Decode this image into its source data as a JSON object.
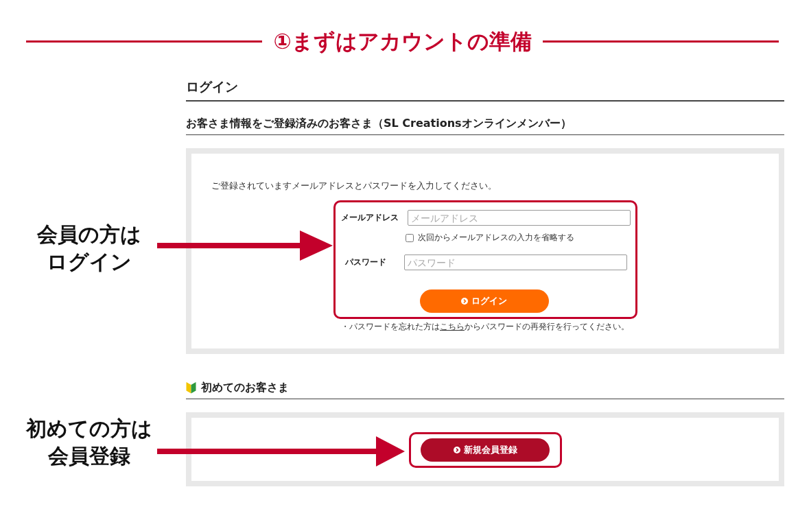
{
  "banner": {
    "title": "①まずはアカウントの準備"
  },
  "login": {
    "title": "ログイン",
    "member_heading": "お客さま情報をご登録済みのお客さま（SL Creationsオンラインメンバー）",
    "instructions": "ご登録されていますメールアドレスとパスワードを入力してください。",
    "email": {
      "label": "メールアドレス",
      "placeholder": "メールアドレス"
    },
    "remember": {
      "label": "次回からメールアドレスの入力を省略する",
      "checked": false
    },
    "password": {
      "label": "パスワード",
      "placeholder": "パスワード"
    },
    "login_button": "ログイン",
    "forgot_note": {
      "before": "・パスワードを忘れた方は",
      "link": "こちら",
      "after": "からパスワードの再発行を行ってください。"
    }
  },
  "new_customer": {
    "heading": "初めてのお客さま",
    "register_button": "新規会員登録"
  },
  "callouts": [
    {
      "lines": [
        "会員の方は",
        "ログイン"
      ]
    },
    {
      "lines": [
        "初めての方は",
        "会員登録"
      ]
    }
  ]
}
